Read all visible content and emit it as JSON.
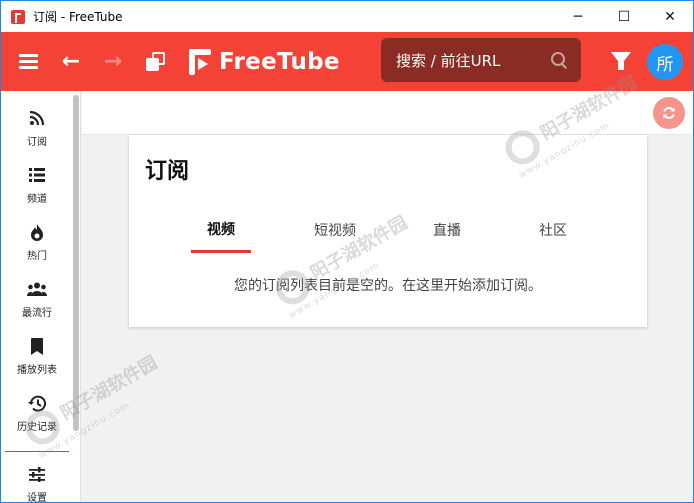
{
  "window": {
    "title": "订阅 - FreeTube",
    "minimize": "─",
    "maximize": "☐",
    "close": "✕"
  },
  "topnav": {
    "logo_text": "FreeTube",
    "search_placeholder": "搜索 / 前往URL",
    "avatar_initial": "所"
  },
  "sidebar": {
    "items": [
      {
        "label": "订阅",
        "icon": "rss-icon",
        "glyph": "⋰"
      },
      {
        "label": "频道",
        "icon": "list-icon",
        "glyph": "☰"
      },
      {
        "label": "热门",
        "icon": "fire-icon",
        "glyph": "🔥"
      },
      {
        "label": "最流行",
        "icon": "users-icon",
        "glyph": "👥"
      },
      {
        "label": "播放列表",
        "icon": "bookmark-icon",
        "glyph": "🔖"
      },
      {
        "label": "历史记录",
        "icon": "history-icon",
        "glyph": "↺"
      },
      {
        "label": "设置",
        "icon": "sliders-icon",
        "glyph": "≡"
      }
    ]
  },
  "main": {
    "title": "订阅",
    "tabs": [
      {
        "label": "视频",
        "active": true
      },
      {
        "label": "短视频",
        "active": false
      },
      {
        "label": "直播",
        "active": false
      },
      {
        "label": "社区",
        "active": false
      }
    ],
    "empty_message": "您的订阅列表目前是空的。在这里开始添加订阅。"
  },
  "watermark": {
    "text": "阳子湖软件园",
    "url": "www.yangzihu.com"
  },
  "colors": {
    "accent": "#f44336",
    "avatar": "#2196f3",
    "search_bg": "#8a2c24"
  }
}
